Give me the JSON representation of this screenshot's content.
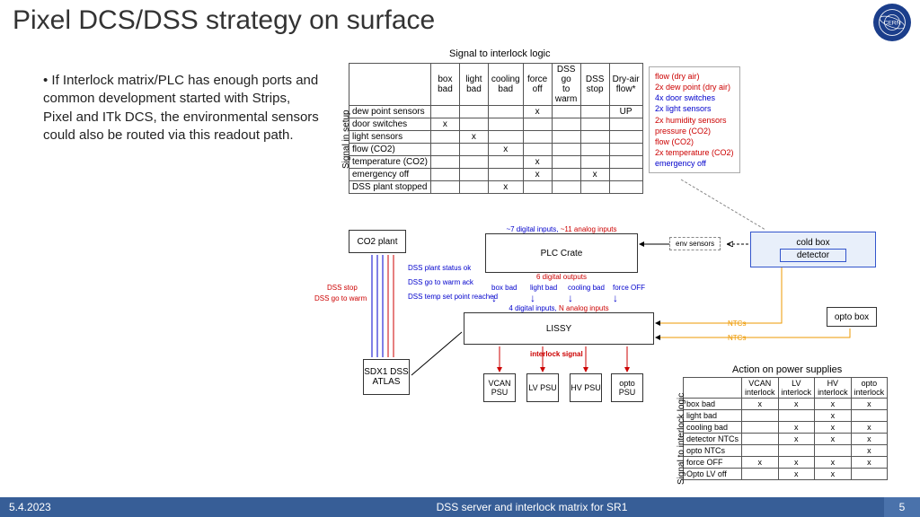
{
  "title": "Pixel DCS/DSS strategy on surface",
  "bullet": "If Interlock matrix/PLC has enough ports and common development started with Strips, Pixel and ITk DCS, the environmental sensors could also be routed via this readout path.",
  "tbl1": {
    "title": "Signal to interlock logic",
    "axis": "Signal in setup",
    "cols": [
      "box bad",
      "light bad",
      "cooling bad",
      "force off",
      "DSS go to warm",
      "DSS stop",
      "Dry-air flow*"
    ],
    "rows": [
      {
        "n": "dew point sensors",
        "c": [
          "",
          "",
          "",
          "x",
          "",
          "",
          "UP"
        ]
      },
      {
        "n": "door switches",
        "c": [
          "x",
          "",
          "",
          "",
          "",
          "",
          ""
        ]
      },
      {
        "n": "light sensors",
        "c": [
          "",
          "x",
          "",
          "",
          "",
          "",
          ""
        ]
      },
      {
        "n": "flow (CO2)",
        "c": [
          "",
          "",
          "x",
          "",
          "",
          "",
          ""
        ]
      },
      {
        "n": "temperature (CO2)",
        "c": [
          "",
          "",
          "",
          "x",
          "",
          "",
          ""
        ]
      },
      {
        "n": "emergency off",
        "c": [
          "",
          "",
          "",
          "x",
          "",
          "x",
          ""
        ]
      },
      {
        "n": "DSS plant stopped",
        "c": [
          "",
          "",
          "x",
          "",
          "",
          "",
          ""
        ]
      }
    ]
  },
  "sensors": [
    {
      "t": "flow (dry air)",
      "c": "red"
    },
    {
      "t": "2x dew point (dry air)",
      "c": "red"
    },
    {
      "t": "4x door switches",
      "c": "blue"
    },
    {
      "t": "2x light sensors",
      "c": "blue"
    },
    {
      "t": "2x humidity sensors",
      "c": "red"
    },
    {
      "t": "pressure (CO2)",
      "c": "red"
    },
    {
      "t": "flow (CO2)",
      "c": "red"
    },
    {
      "t": "2x temperature (CO2)",
      "c": "red"
    },
    {
      "t": "emergency off",
      "c": "blue"
    }
  ],
  "tbl2": {
    "title": "Action on power supplies",
    "axis": "Signal to interlock logic",
    "cols": [
      "VCAN interlock",
      "LV interlock",
      "HV interlock",
      "opto interlock"
    ],
    "rows": [
      {
        "n": "box bad",
        "c": [
          "x",
          "x",
          "x",
          "x"
        ]
      },
      {
        "n": "light bad",
        "c": [
          "",
          "",
          "x",
          ""
        ]
      },
      {
        "n": "cooling bad",
        "c": [
          "",
          "x",
          "x",
          "x"
        ]
      },
      {
        "n": "detector NTCs",
        "c": [
          "",
          "x",
          "x",
          "x"
        ]
      },
      {
        "n": "opto NTCs",
        "c": [
          "",
          "",
          "",
          "x"
        ]
      },
      {
        "n": "force OFF",
        "c": [
          "x",
          "x",
          "x",
          "x"
        ]
      },
      {
        "n": "Opto LV off",
        "c": [
          "",
          "x",
          "x",
          ""
        ]
      }
    ]
  },
  "boxes": {
    "co2": "CO2 plant",
    "plc": "PLC Crate",
    "plc_above_digital": "~7 digital inputs,",
    "plc_above_analog": "~11 analog inputs",
    "plc_below": "6 digital outputs",
    "lissy": "LISSY",
    "lissy_above_digital": "4 digital inputs,",
    "lissy_above_analog": "N analog inputs",
    "sdx": "SDX1 DSS ATLAS",
    "psu": [
      "VCAN PSU",
      "LV PSU",
      "HV PSU",
      "opto PSU"
    ],
    "cold": "cold box",
    "detector": "detector",
    "opto": "opto box",
    "env": "env sensors"
  },
  "labels": {
    "dss_stop": "DSS stop",
    "dss_warm": "DSS go to warm",
    "dss_status": "DSS plant status ok",
    "dss_ack": "DSS go to warm ack",
    "dss_temp": "DSS temp set point reached",
    "box_bad": "box bad",
    "light_bad": "light bad",
    "cooling_bad": "cooling bad",
    "force_off": "force OFF",
    "interlock": "interlock signal",
    "ntc": "NTCs"
  },
  "footer": {
    "date": "5.4.2023",
    "mid": "DSS server and interlock matrix for SR1",
    "page": "5"
  }
}
